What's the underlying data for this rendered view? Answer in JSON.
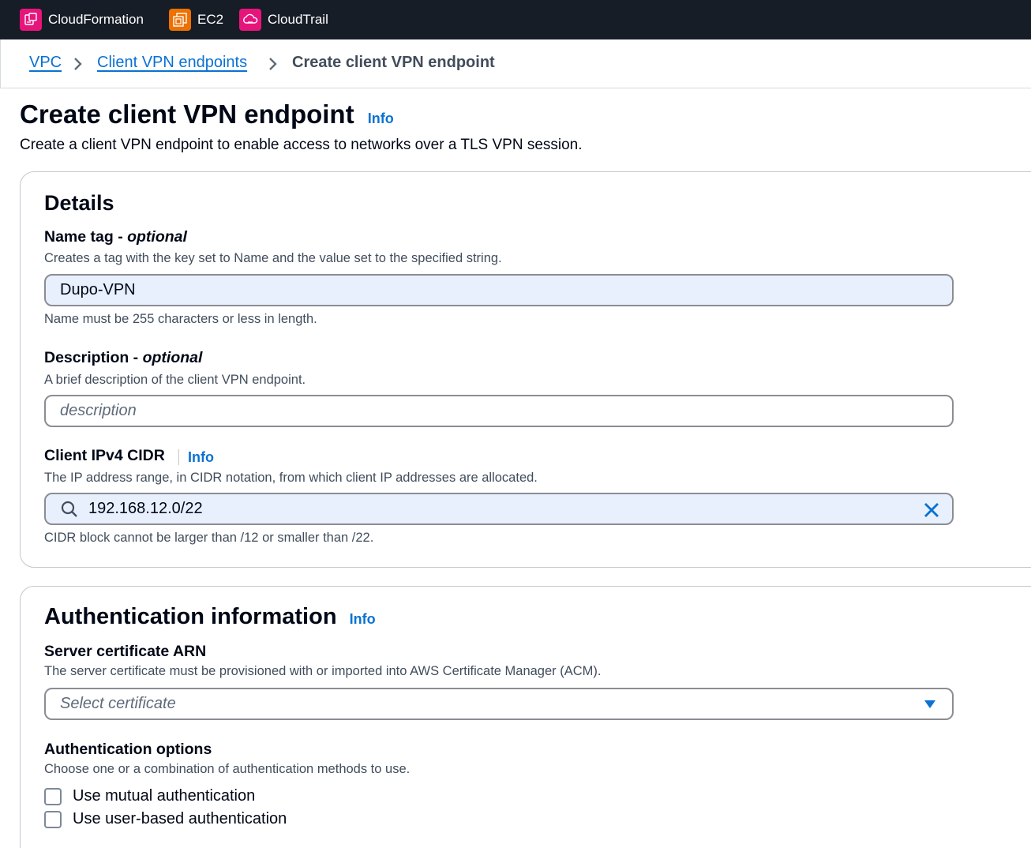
{
  "topbar": {
    "services": [
      {
        "label": "CloudFormation",
        "icon": "cloudformation-icon",
        "color": "#e7157b"
      },
      {
        "label": "EC2",
        "icon": "ec2-icon",
        "color": "#ed7100"
      },
      {
        "label": "CloudTrail",
        "icon": "cloudtrail-icon",
        "color": "#e7157b"
      }
    ]
  },
  "breadcrumb": {
    "items": [
      "VPC",
      "Client VPN endpoints",
      "Create client VPN endpoint"
    ]
  },
  "header": {
    "title": "Create client VPN endpoint",
    "info": "Info",
    "description": "Create a client VPN endpoint to enable access to networks over a TLS VPN session."
  },
  "details": {
    "title": "Details",
    "name_tag": {
      "label": "Name tag - ",
      "optional": "optional",
      "help": "Creates a tag with the key set to Name and the value set to the specified string.",
      "value": "Dupo-VPN",
      "constraint": "Name must be 255 characters or less in length."
    },
    "description": {
      "label": "Description - ",
      "optional": "optional",
      "help": "A brief description of the client VPN endpoint.",
      "placeholder": "description"
    },
    "cidr": {
      "label": "Client IPv4 CIDR",
      "info": "Info",
      "help": "The IP address range, in CIDR notation, from which client IP addresses are allocated.",
      "value": "192.168.12.0/22",
      "constraint": "CIDR block cannot be larger than /12 or smaller than /22."
    }
  },
  "auth": {
    "title": "Authentication information",
    "info": "Info",
    "server_cert": {
      "label": "Server certificate ARN",
      "help": "The server certificate must be provisioned with or imported into AWS Certificate Manager (ACM).",
      "placeholder": "Select certificate"
    },
    "options": {
      "label": "Authentication options",
      "help": "Choose one or a combination of authentication methods to use.",
      "mutual": "Use mutual authentication",
      "user_based": "Use user-based authentication"
    }
  },
  "colors": {
    "link": "#0972d3",
    "topbar": "#161d26",
    "input_fill": "#e8f0fe"
  }
}
